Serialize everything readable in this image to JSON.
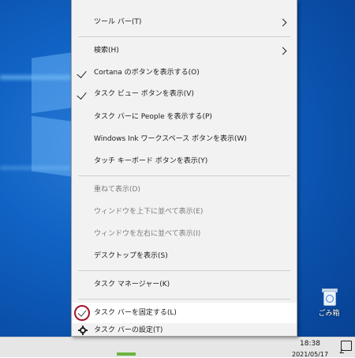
{
  "menu": {
    "items": [
      {
        "label": "ツール バー(T)",
        "has_submenu": true
      },
      {
        "label": "検索(H)",
        "has_submenu": true
      },
      {
        "label": "Cortana のボタンを表示する(O)",
        "checked": true
      },
      {
        "label": "タスク ビュー ボタンを表示(V)",
        "checked": true
      },
      {
        "label": "タスク バーに People を表示する(P)"
      },
      {
        "label": "Windows Ink ワークスペース ボタンを表示(W)"
      },
      {
        "label": "タッチ キーボード ボタンを表示(Y)"
      },
      {
        "label": "重ねて表示(D)",
        "disabled": true
      },
      {
        "label": "ウィンドウを上下に並べて表示(E)",
        "disabled": true
      },
      {
        "label": "ウィンドウを左右に並べて表示(I)",
        "disabled": true
      },
      {
        "label": "デスクトップを表示(S)"
      },
      {
        "label": "タスク マネージャー(K)"
      },
      {
        "label": "タスク バーを固定する(L)",
        "checked": true,
        "highlighted": true
      },
      {
        "label": "タスク バーの設定(T)",
        "icon": "gear-icon"
      }
    ]
  },
  "desktop": {
    "recycle_bin_label": "ごみ箱"
  },
  "taskbar": {
    "time": "18:38",
    "date": "2021/05/17"
  },
  "colors": {
    "desktop_blue": "#0a4ea8",
    "menu_bg": "#f2f2f2",
    "highlight_ring": "#a3142a"
  }
}
